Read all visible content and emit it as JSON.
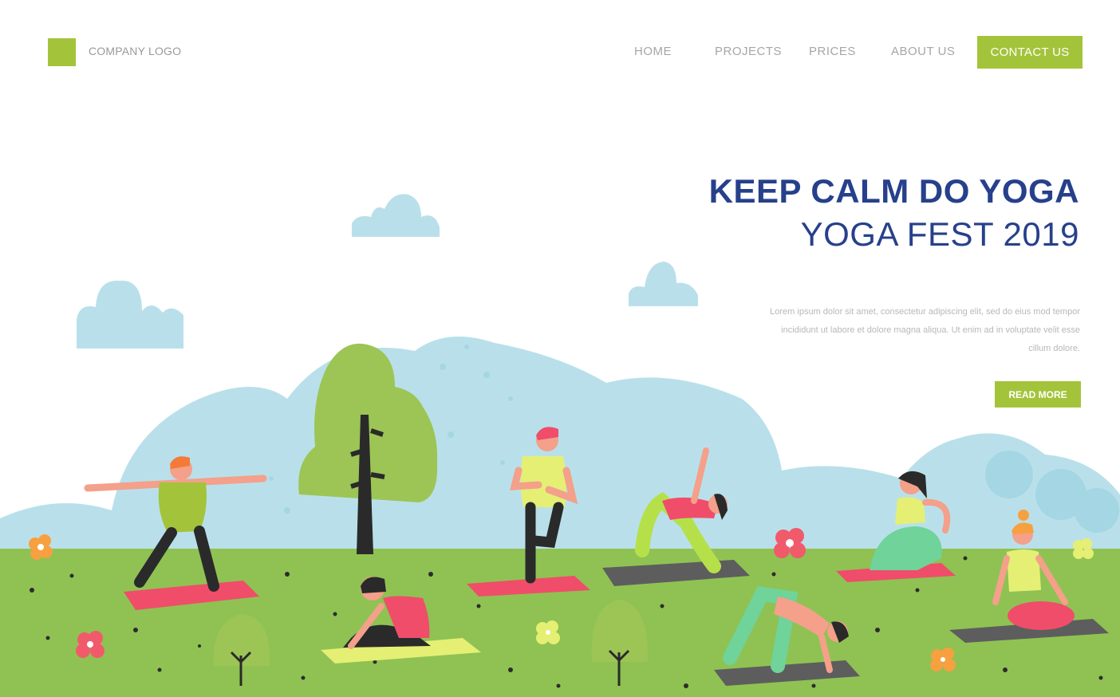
{
  "header": {
    "logo_text": "COMPANY LOGO",
    "nav": [
      {
        "label": "HOME"
      },
      {
        "label": "PROJECTS"
      },
      {
        "label": "PRICES"
      },
      {
        "label": "ABOUT US"
      }
    ],
    "contact_label": "CONTACT US"
  },
  "hero": {
    "title": "KEEP CALM DO YOGA",
    "subtitle": "YOGA FEST 2019",
    "body": "Lorem ipsum dolor sit amet, consectetur adipiscing elit, sed do eius mod tempor incididunt ut labore et dolore magna aliqua. Ut enim ad in voluptate velit esse cillum dolore.",
    "read_more_label": "READ MORE"
  },
  "colors": {
    "accent": "#a3c43a",
    "title": "#27408b",
    "grass": "#8fc253",
    "hills": "#b9e0ea",
    "mat_pink": "#f04d6a",
    "mat_gray": "#5d5d5d",
    "mat_yellow": "#e4ef74"
  }
}
